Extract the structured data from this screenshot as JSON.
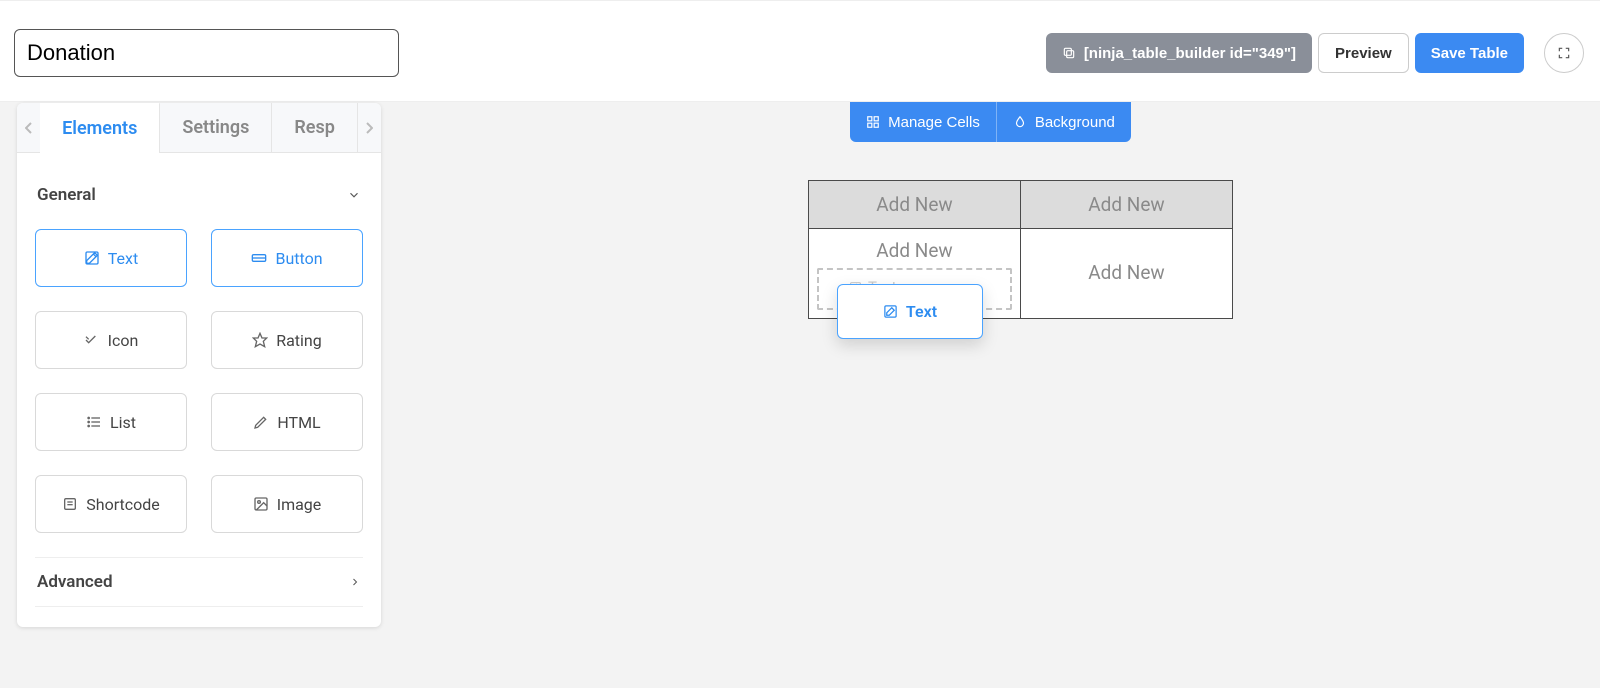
{
  "header": {
    "title_value": "Donation",
    "shortcode": "[ninja_table_builder id=\"349\"]",
    "preview_label": "Preview",
    "save_label": "Save Table"
  },
  "sidebar": {
    "tabs": {
      "elements": "Elements",
      "settings": "Settings",
      "responsive": "Resp"
    },
    "sections": {
      "general": {
        "title": "General",
        "items": {
          "text": "Text",
          "button": "Button",
          "icon": "Icon",
          "rating": "Rating",
          "list": "List",
          "html": "HTML",
          "shortcode": "Shortcode",
          "image": "Image"
        }
      },
      "advanced": {
        "title": "Advanced"
      }
    }
  },
  "canvas": {
    "toolbar": {
      "manage_cells": "Manage Cells",
      "background": "Background"
    },
    "table": {
      "header_cells": [
        "Add New",
        "Add New"
      ],
      "body_cells": [
        "Add New",
        "Add New"
      ]
    },
    "drag": {
      "ghost_label": "Text",
      "chip_label": "Text"
    }
  }
}
